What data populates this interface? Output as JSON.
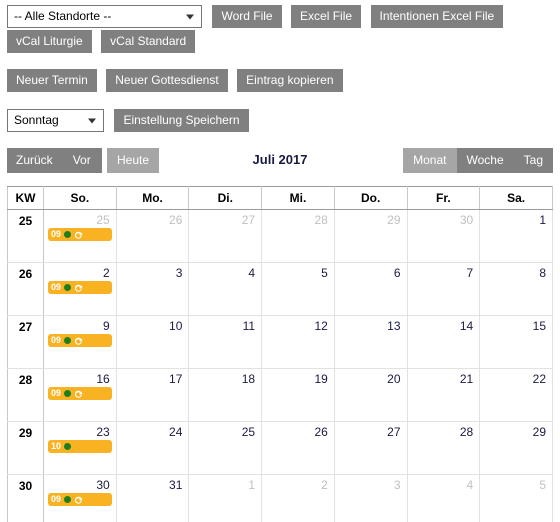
{
  "toolbar": {
    "site_select": {
      "value": "-- Alle Standorte --",
      "icon": "chevron-down-icon"
    },
    "export_buttons": [
      {
        "label": "Word File"
      },
      {
        "label": "Excel File"
      },
      {
        "label": "Intentionen Excel File"
      }
    ],
    "vcal_buttons": [
      {
        "label": "vCal Liturgie"
      },
      {
        "label": "vCal Standard"
      }
    ],
    "action_buttons": [
      {
        "label": "Neuer Termin"
      },
      {
        "label": "Neuer Gottesdienst"
      },
      {
        "label": "Eintrag kopieren"
      }
    ],
    "weekday_select": {
      "value": "Sonntag",
      "icon": "chevron-down-icon"
    },
    "save_setting_label": "Einstellung Speichern"
  },
  "calendar_nav": {
    "prev_label": "Zurück",
    "next_label": "Vor",
    "today_label": "Heute",
    "title": "Juli 2017",
    "views": [
      {
        "label": "Monat",
        "active": true
      },
      {
        "label": "Woche",
        "active": false
      },
      {
        "label": "Tag",
        "active": false
      }
    ]
  },
  "calendar": {
    "headers": [
      "KW",
      "So.",
      "Mo.",
      "Di.",
      "Mi.",
      "Do.",
      "Fr.",
      "Sa."
    ],
    "weeks": [
      {
        "kw": "25",
        "days": [
          {
            "num": "25",
            "other": true,
            "today": false,
            "events": [
              {
                "hour": "09",
                "dot": "green",
                "recurring": true
              }
            ]
          },
          {
            "num": "26",
            "other": true,
            "today": false,
            "events": []
          },
          {
            "num": "27",
            "other": true,
            "today": false,
            "events": []
          },
          {
            "num": "28",
            "other": true,
            "today": false,
            "events": []
          },
          {
            "num": "29",
            "other": true,
            "today": false,
            "events": []
          },
          {
            "num": "30",
            "other": true,
            "today": false,
            "events": []
          },
          {
            "num": "1",
            "other": false,
            "today": false,
            "events": []
          }
        ]
      },
      {
        "kw": "26",
        "days": [
          {
            "num": "2",
            "other": false,
            "today": false,
            "events": [
              {
                "hour": "09",
                "dot": "green",
                "recurring": true
              }
            ]
          },
          {
            "num": "3",
            "other": false,
            "today": false,
            "events": []
          },
          {
            "num": "4",
            "other": false,
            "today": false,
            "events": []
          },
          {
            "num": "5",
            "other": false,
            "today": true,
            "events": []
          },
          {
            "num": "6",
            "other": false,
            "today": false,
            "events": []
          },
          {
            "num": "7",
            "other": false,
            "today": false,
            "events": []
          },
          {
            "num": "8",
            "other": false,
            "today": false,
            "events": []
          }
        ]
      },
      {
        "kw": "27",
        "days": [
          {
            "num": "9",
            "other": false,
            "today": false,
            "events": [
              {
                "hour": "09",
                "dot": "green",
                "recurring": true
              }
            ]
          },
          {
            "num": "10",
            "other": false,
            "today": false,
            "events": []
          },
          {
            "num": "11",
            "other": false,
            "today": false,
            "events": []
          },
          {
            "num": "12",
            "other": false,
            "today": false,
            "events": []
          },
          {
            "num": "13",
            "other": false,
            "today": false,
            "events": []
          },
          {
            "num": "14",
            "other": false,
            "today": false,
            "events": []
          },
          {
            "num": "15",
            "other": false,
            "today": false,
            "events": []
          }
        ]
      },
      {
        "kw": "28",
        "days": [
          {
            "num": "16",
            "other": false,
            "today": false,
            "events": [
              {
                "hour": "09",
                "dot": "green",
                "recurring": true
              }
            ]
          },
          {
            "num": "17",
            "other": false,
            "today": false,
            "events": []
          },
          {
            "num": "18",
            "other": false,
            "today": false,
            "events": []
          },
          {
            "num": "19",
            "other": false,
            "today": false,
            "events": []
          },
          {
            "num": "20",
            "other": false,
            "today": false,
            "events": []
          },
          {
            "num": "21",
            "other": false,
            "today": false,
            "events": []
          },
          {
            "num": "22",
            "other": false,
            "today": false,
            "events": []
          }
        ]
      },
      {
        "kw": "29",
        "days": [
          {
            "num": "23",
            "other": false,
            "today": false,
            "events": [
              {
                "hour": "10",
                "dot": "green",
                "recurring": false
              }
            ]
          },
          {
            "num": "24",
            "other": false,
            "today": false,
            "events": []
          },
          {
            "num": "25",
            "other": false,
            "today": false,
            "events": []
          },
          {
            "num": "26",
            "other": false,
            "today": false,
            "events": []
          },
          {
            "num": "27",
            "other": false,
            "today": false,
            "events": []
          },
          {
            "num": "28",
            "other": false,
            "today": false,
            "events": []
          },
          {
            "num": "29",
            "other": false,
            "today": false,
            "events": []
          }
        ]
      },
      {
        "kw": "30",
        "days": [
          {
            "num": "30",
            "other": false,
            "today": false,
            "events": [
              {
                "hour": "09",
                "dot": "green",
                "recurring": true
              }
            ]
          },
          {
            "num": "31",
            "other": false,
            "today": false,
            "events": []
          },
          {
            "num": "1",
            "other": true,
            "today": false,
            "events": []
          },
          {
            "num": "2",
            "other": true,
            "today": false,
            "events": []
          },
          {
            "num": "3",
            "other": true,
            "today": false,
            "events": []
          },
          {
            "num": "4",
            "other": true,
            "today": false,
            "events": []
          },
          {
            "num": "5",
            "other": true,
            "today": false,
            "events": []
          }
        ]
      }
    ]
  },
  "colors": {
    "button_gray": "#808080",
    "button_light_gray": "#a6a6a6",
    "event_orange": "#f9b322",
    "event_dot_green": "#1e7d1e",
    "today_background": "#fcf8e3",
    "title_navy": "#1a1a44",
    "muted_day": "#c0c0c0"
  }
}
